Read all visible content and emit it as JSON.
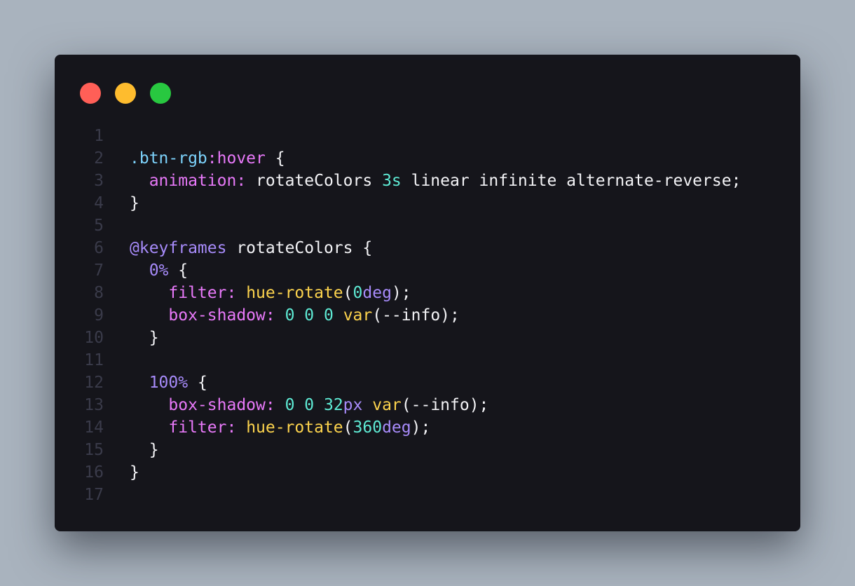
{
  "window": {
    "controls": [
      "close",
      "minimize",
      "maximize"
    ]
  },
  "code": {
    "language": "css",
    "line_numbers": [
      "1",
      "2",
      "3",
      "4",
      "5",
      "6",
      "7",
      "8",
      "9",
      "10",
      "11",
      "12",
      "13",
      "14",
      "15",
      "16",
      "17"
    ],
    "lines": [
      [],
      [
        {
          "t": ".btn-rgb",
          "c": "selector"
        },
        {
          "t": ":hover",
          "c": "pseudo"
        },
        {
          "t": " {",
          "c": "plain"
        }
      ],
      [
        {
          "t": "  ",
          "c": "plain"
        },
        {
          "t": "animation:",
          "c": "prop"
        },
        {
          "t": " rotateColors ",
          "c": "plain"
        },
        {
          "t": "3s",
          "c": "num"
        },
        {
          "t": " linear infinite alternate-reverse;",
          "c": "plain"
        }
      ],
      [
        {
          "t": "}",
          "c": "plain"
        }
      ],
      [],
      [
        {
          "t": "@keyframes",
          "c": "at"
        },
        {
          "t": " rotateColors {",
          "c": "plain"
        }
      ],
      [
        {
          "t": "  ",
          "c": "plain"
        },
        {
          "t": "0%",
          "c": "pct"
        },
        {
          "t": " {",
          "c": "plain"
        }
      ],
      [
        {
          "t": "    ",
          "c": "plain"
        },
        {
          "t": "filter:",
          "c": "prop"
        },
        {
          "t": " ",
          "c": "plain"
        },
        {
          "t": "hue-rotate",
          "c": "fn"
        },
        {
          "t": "(",
          "c": "plain"
        },
        {
          "t": "0",
          "c": "num"
        },
        {
          "t": "deg",
          "c": "unit"
        },
        {
          "t": ");",
          "c": "plain"
        }
      ],
      [
        {
          "t": "    ",
          "c": "plain"
        },
        {
          "t": "box-shadow:",
          "c": "prop"
        },
        {
          "t": " ",
          "c": "plain"
        },
        {
          "t": "0 0 0",
          "c": "num"
        },
        {
          "t": " ",
          "c": "plain"
        },
        {
          "t": "var",
          "c": "fn"
        },
        {
          "t": "(--info);",
          "c": "plain"
        }
      ],
      [
        {
          "t": "  }",
          "c": "plain"
        }
      ],
      [],
      [
        {
          "t": "  ",
          "c": "plain"
        },
        {
          "t": "100%",
          "c": "pct"
        },
        {
          "t": " {",
          "c": "plain"
        }
      ],
      [
        {
          "t": "    ",
          "c": "plain"
        },
        {
          "t": "box-shadow:",
          "c": "prop"
        },
        {
          "t": " ",
          "c": "plain"
        },
        {
          "t": "0 0 32",
          "c": "num"
        },
        {
          "t": "px",
          "c": "unit"
        },
        {
          "t": " ",
          "c": "plain"
        },
        {
          "t": "var",
          "c": "fn"
        },
        {
          "t": "(--info);",
          "c": "plain"
        }
      ],
      [
        {
          "t": "    ",
          "c": "plain"
        },
        {
          "t": "filter:",
          "c": "prop"
        },
        {
          "t": " ",
          "c": "plain"
        },
        {
          "t": "hue-rotate",
          "c": "fn"
        },
        {
          "t": "(",
          "c": "plain"
        },
        {
          "t": "360",
          "c": "num"
        },
        {
          "t": "deg",
          "c": "unit"
        },
        {
          "t": ");",
          "c": "plain"
        }
      ],
      [
        {
          "t": "  }",
          "c": "plain"
        }
      ],
      [
        {
          "t": "}",
          "c": "plain"
        }
      ],
      []
    ]
  },
  "colors": {
    "background": "#a9b3be",
    "window": "#15151b",
    "close": "#ff5f57",
    "minimize": "#febc2e",
    "maximize": "#28c840",
    "selector": "#7dd3fc",
    "property": "#e879f9",
    "keyword": "#a78bfa",
    "number": "#5eead4",
    "function": "#fcd34d",
    "line_number": "#3a3b4a"
  }
}
